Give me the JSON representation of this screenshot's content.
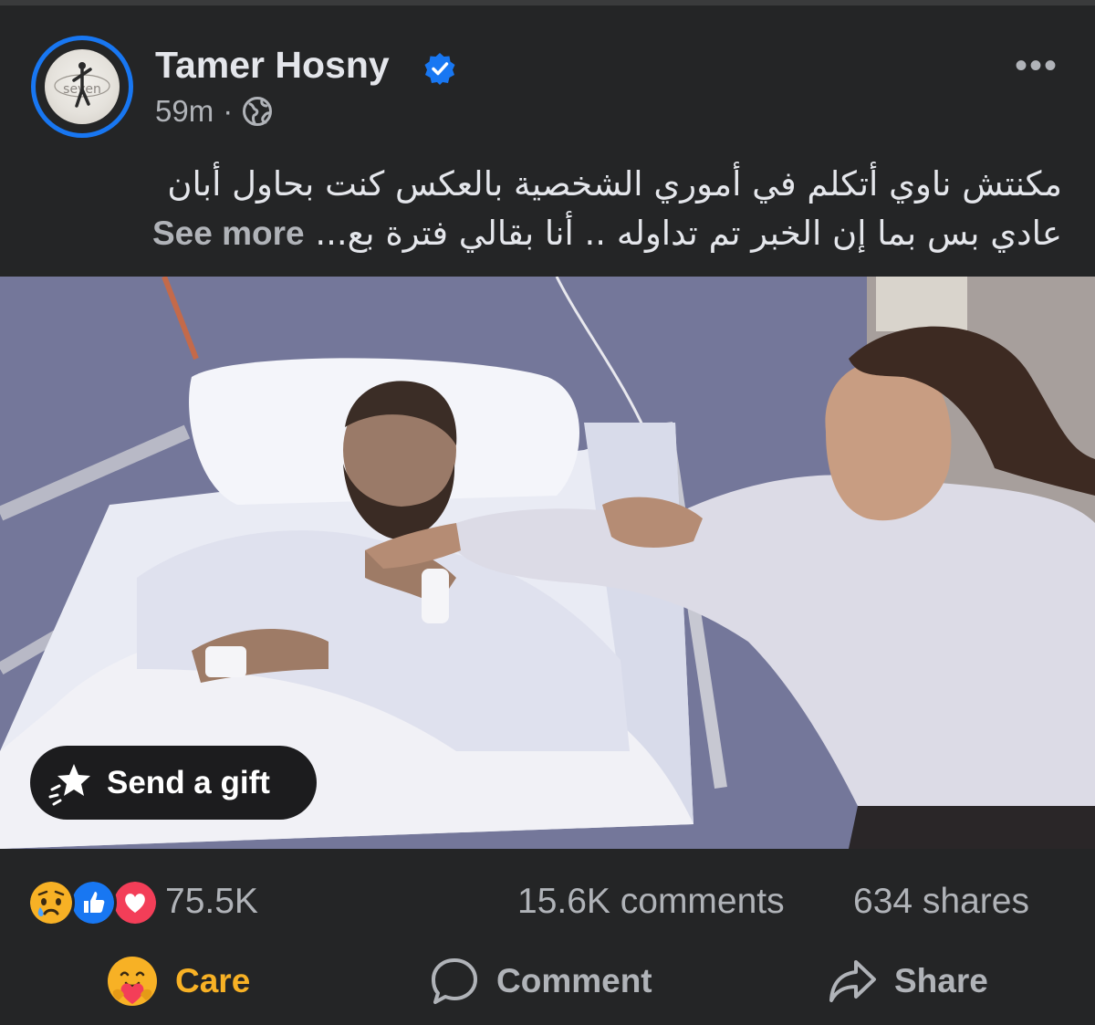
{
  "post": {
    "author": "Tamer Hosny",
    "time": "59m",
    "separator": "·",
    "more_icon": "•••",
    "caption_line1": "مكنتش ناوي أتكلم في أموري الشخصية بالعكس كنت بحاول أبان",
    "caption_line2": "عادي بس بما إن الخبر تم تداوله .. أنا بقالي فترة بع",
    "ellipsis": "...",
    "see_more": "See more",
    "avatar_text": "seven"
  },
  "media": {
    "gift_button": "Send a gift"
  },
  "stats": {
    "reactions_count": "75.5K",
    "comments": "15.6K comments",
    "shares": "634 shares",
    "reaction_icons": [
      "sad-reaction-icon",
      "like-reaction-icon",
      "love-reaction-icon"
    ]
  },
  "actions": {
    "care": "Care",
    "comment": "Comment",
    "share": "Share"
  },
  "colors": {
    "background": "#242526",
    "verified": "#1877f2",
    "care": "#f7b125",
    "muted": "#b0b3b8"
  }
}
